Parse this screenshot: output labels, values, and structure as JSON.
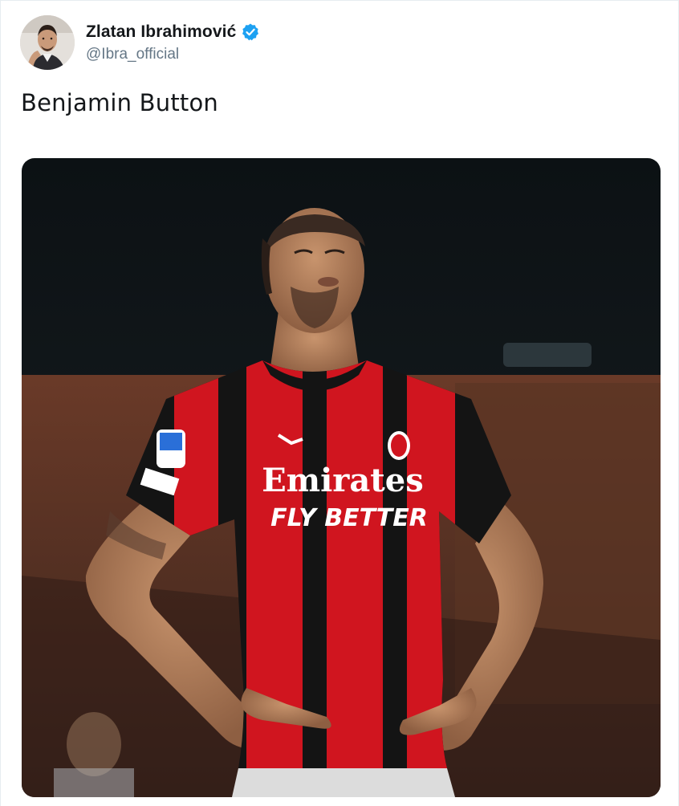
{
  "tweet": {
    "author": {
      "display_name": "Zlatan Ibrahimović",
      "handle": "@Ibra_official",
      "verified": true,
      "verified_icon": "verified-badge-icon"
    },
    "text": "Benjamin Button",
    "media": {
      "jersey_sponsor_line1": "Emirates",
      "jersey_sponsor_line2": "FLY BETTER"
    }
  },
  "colors": {
    "verified_blue": "#1da1f2",
    "handle_gray": "#657786",
    "text_dark": "#14171a",
    "milan_red": "#d0151f",
    "milan_black": "#111111"
  }
}
